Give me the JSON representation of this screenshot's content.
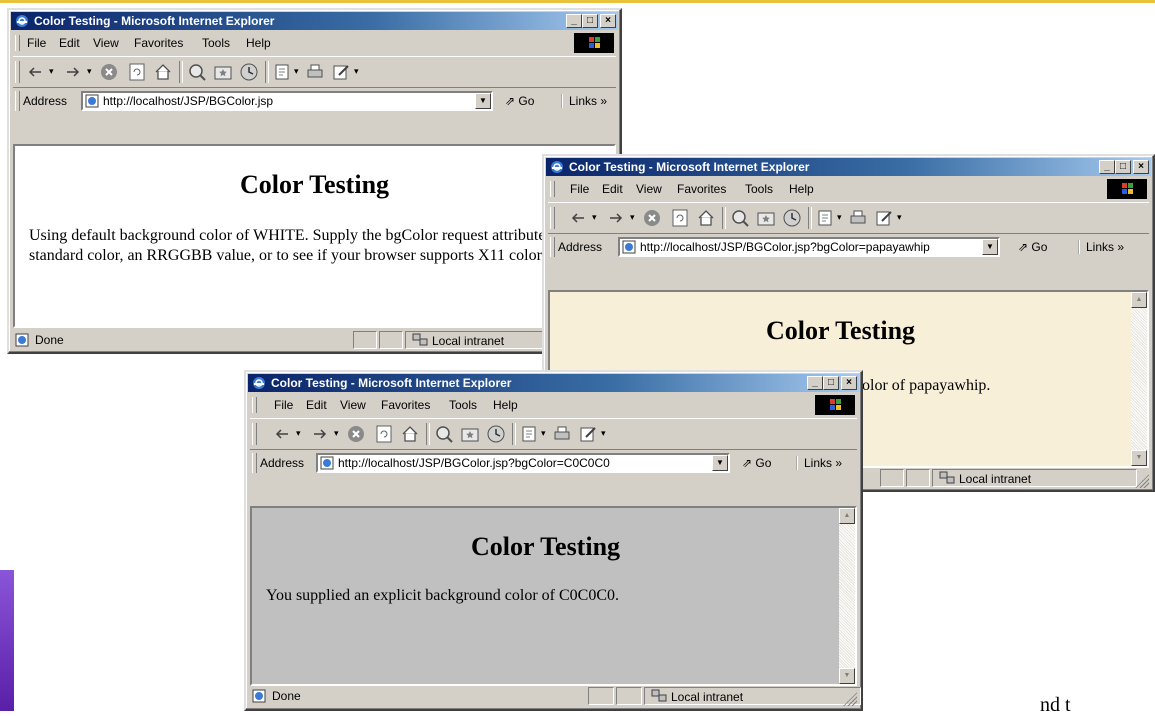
{
  "windows": [
    {
      "title": "Color Testing - Microsoft Internet Explorer",
      "menu": [
        "File",
        "Edit",
        "View",
        "Favorites",
        "Tools",
        "Help"
      ],
      "address_label": "Address",
      "url": "http://localhost/JSP/BGColor.jsp",
      "go_label": "Go",
      "links_label": "Links",
      "page_heading": "Color Testing",
      "page_text": "Using default background color of WHITE. Supply the bgColor request attribute to try a standard color, an RRGGBB value, or to see if your browser supports X11 color names.",
      "status_text": "Done",
      "zone_text": "Local intranet",
      "background_color": "#ffffff"
    },
    {
      "title": "Color Testing - Microsoft Internet Explorer",
      "menu": [
        "File",
        "Edit",
        "View",
        "Favorites",
        "Tools",
        "Help"
      ],
      "address_label": "Address",
      "url": "http://localhost/JSP/BGColor.jsp?bgColor=papayawhip",
      "go_label": "Go",
      "links_label": "Links",
      "page_heading": "Color Testing",
      "page_text": "olor of papayawhip.",
      "status_text": "",
      "zone_text": "Local intranet",
      "background_color": "#f8efd8"
    },
    {
      "title": "Color Testing - Microsoft Internet Explorer",
      "menu": [
        "File",
        "Edit",
        "View",
        "Favorites",
        "Tools",
        "Help"
      ],
      "address_label": "Address",
      "url": "http://localhost/JSP/BGColor.jsp?bgColor=C0C0C0",
      "go_label": "Go",
      "links_label": "Links",
      "page_heading": "Color Testing",
      "page_text": "You supplied an explicit background color of C0C0C0.",
      "status_text": "Done",
      "zone_text": "Local intranet",
      "background_color": "#c0c0c0"
    }
  ],
  "window_buttons": {
    "minimize": "_",
    "maximize": "□",
    "close": "×"
  },
  "toolbar_icons": [
    "back-icon",
    "forward-icon",
    "stop-icon",
    "refresh-icon",
    "home-icon",
    "search-icon",
    "favorites-icon",
    "history-icon",
    "mail-icon",
    "print-icon",
    "edit-icon"
  ],
  "slide_corner_text": "nd t",
  "colors": {
    "titlebar_start": "#0a246a",
    "titlebar_end": "#a6caf0",
    "chrome": "#d4d0c8",
    "slide_accent": "#6a2fbf",
    "slide_border": "#e8c23a"
  }
}
